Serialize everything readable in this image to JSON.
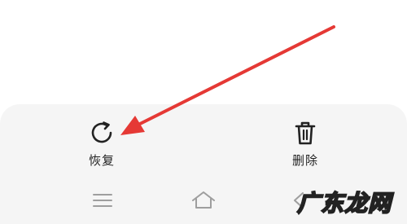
{
  "actions": {
    "restore_label": "恢复",
    "restore_icon": "restore-icon",
    "delete_label": "删除",
    "delete_icon": "trash-icon"
  },
  "nav": {
    "menu_icon": "menu-icon",
    "home_icon": "home-icon",
    "back_icon": "back-icon"
  },
  "annotation": {
    "arrow_color": "#e53935"
  },
  "watermark": {
    "text": "广东龙网"
  }
}
